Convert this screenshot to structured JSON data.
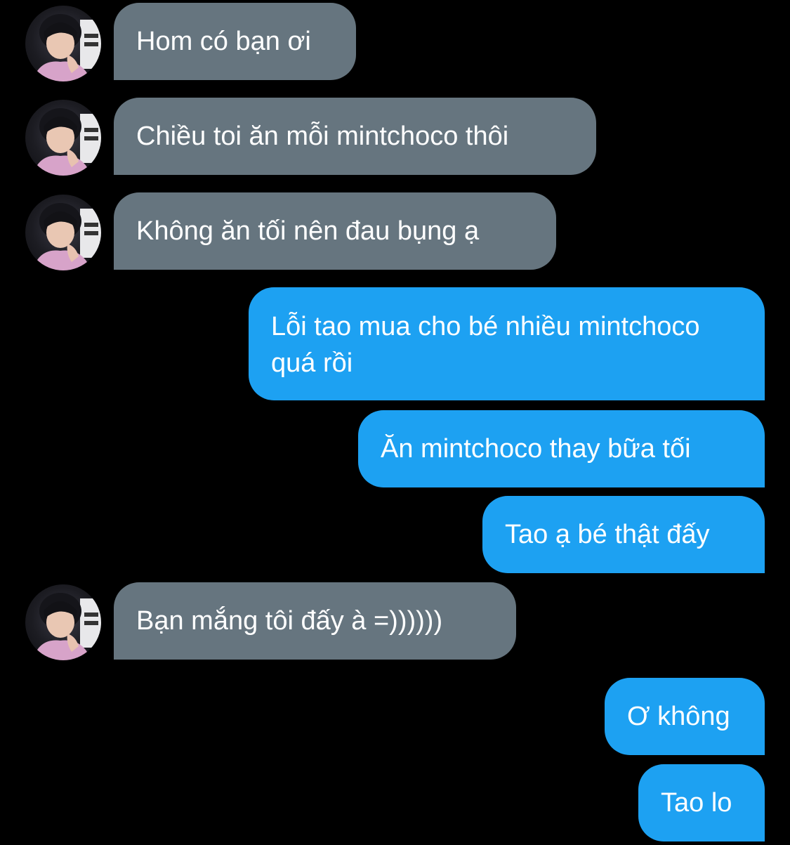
{
  "conversation": {
    "messages": [
      {
        "direction": "incoming",
        "text": "Hom có bạn ơi"
      },
      {
        "direction": "incoming",
        "text": "Chiều toi ăn mỗi mintchoco thôi"
      },
      {
        "direction": "incoming",
        "text": "Không ăn tối nên đau bụng ạ"
      },
      {
        "direction": "outgoing",
        "text": "Lỗi tao mua cho bé nhiều mintchoco quá rồi"
      },
      {
        "direction": "outgoing",
        "text": "Ăn mintchoco thay bữa tối"
      },
      {
        "direction": "outgoing",
        "text": "Tao ạ bé thật đấy"
      },
      {
        "direction": "incoming",
        "text": "Bạn mắng tôi đấy à =))))))"
      },
      {
        "direction": "outgoing",
        "text": "Ơ không"
      },
      {
        "direction": "outgoing",
        "text": "Tao lo"
      }
    ]
  },
  "colors": {
    "background": "#000000",
    "incoming_bubble": "#66757f",
    "outgoing_bubble": "#1da1f2",
    "text": "#ffffff"
  },
  "icons": {
    "contact_avatar": "avatar"
  }
}
